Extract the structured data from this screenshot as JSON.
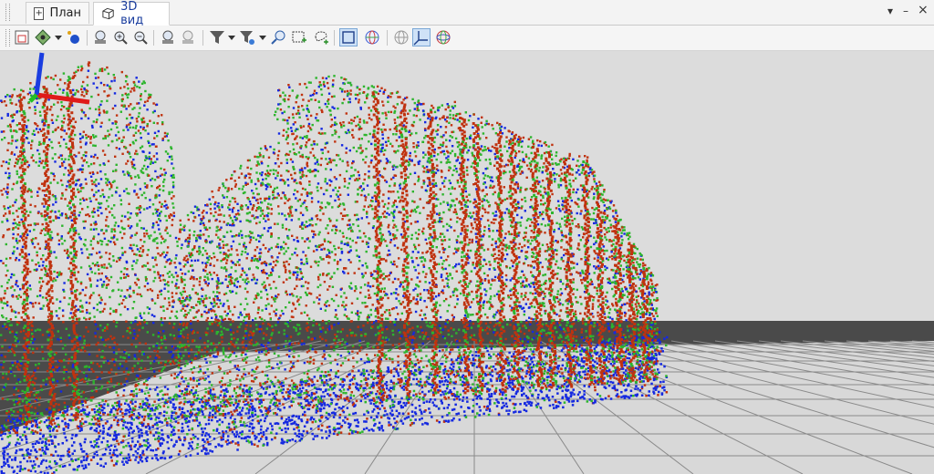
{
  "tabs": [
    {
      "label": "План",
      "icon": "plan-icon",
      "active": false
    },
    {
      "label": "3D вид",
      "icon": "3d-cube-icon",
      "active": true
    }
  ],
  "window_controls": {
    "menu": "▾",
    "minimize": "–",
    "close": "×"
  },
  "toolbar": {
    "items": [
      "frame-view-icon",
      "navigation-mode-icon",
      "point-style-icon",
      "zoom-in-icon",
      "zoom-area-icon",
      "zoom-out-icon",
      "zoom-extents-icon",
      "zoom-previous-icon",
      "filter-icon",
      "filter-settings-icon",
      "pick-point-icon",
      "select-rectangle-icon",
      "select-polygon-icon",
      "bounding-box-icon",
      "globe-view-icon",
      "globe-grid-icon",
      "axes-icon",
      "sphere-icon"
    ]
  },
  "colors": {
    "background": "#dcdcdc",
    "floor_dark": "#4a4a4a",
    "points_red": "#c0320f",
    "points_green": "#2db52d",
    "points_blue": "#1428e0",
    "axis_x": "#e01a1a",
    "axis_y": "#22c022",
    "axis_z": "#1a3de0"
  }
}
